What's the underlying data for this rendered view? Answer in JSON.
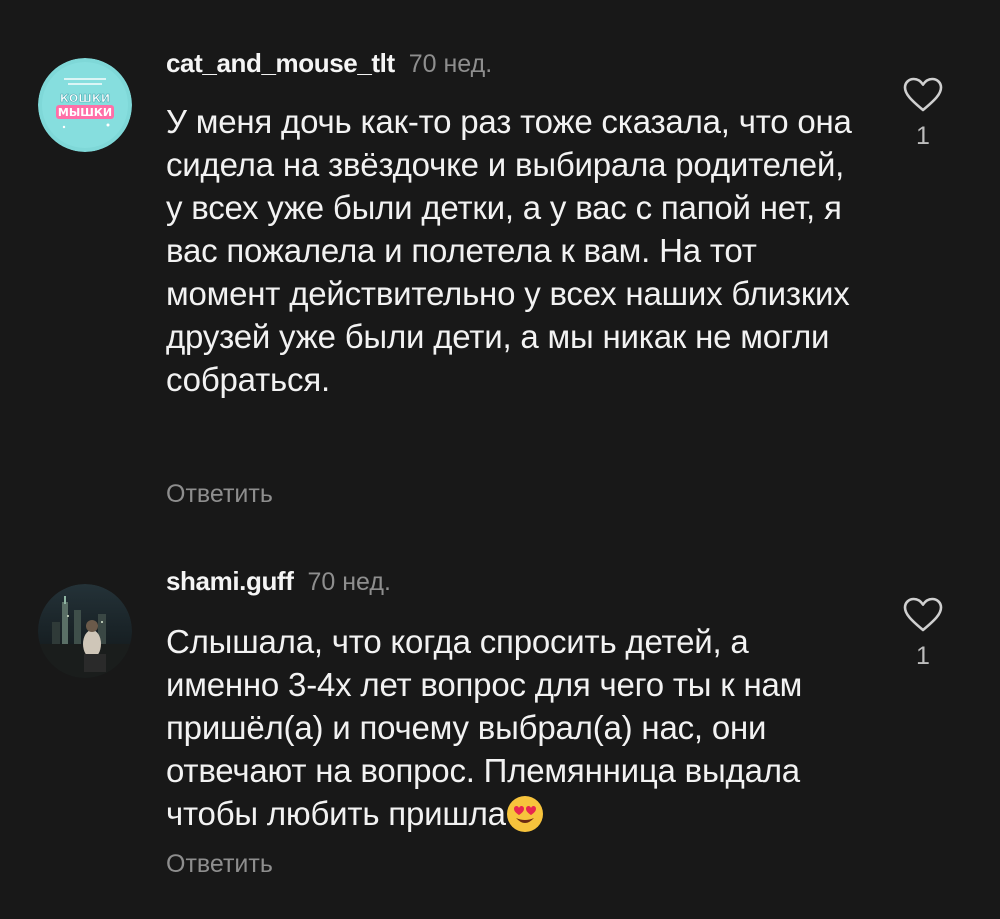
{
  "comments": [
    {
      "username": "cat_and_mouse_tlt",
      "time": "70 нед.",
      "text": "У меня дочь как-то раз тоже сказала, что она сидела на звёздочке и выбирала родителей, у всех уже были детки, а у вас с папой нет, я вас пожалела и полетела к вам. На тот момент действительно у всех наших близких друзей уже были дети, а мы никак не могли собраться.",
      "reply_label": "Ответить",
      "likes": "1",
      "avatar_text_top": "ДЕТСКАЯ ИГРОВАЯ СТУДИЯ",
      "avatar_text_main1": "КОШКИ",
      "avatar_text_main2": "МЫШКИ"
    },
    {
      "username": "shami.guff",
      "time": "70 нед.",
      "text": "Слышала, что когда спросить детей, а именно 3-4х лет вопрос для чего ты к нам пришёл(а) и почему выбрал(а) нас, они отвечают на вопрос. Племянница выдала чтобы любить пришла",
      "emoji": "heart-eyes-emoji",
      "reply_label": "Ответить",
      "likes": "1"
    }
  ],
  "colors": {
    "background": "#181818",
    "text": "#f2f2f2",
    "secondary": "#8e8e8e",
    "avatar_brand": "#7fd8d8"
  }
}
